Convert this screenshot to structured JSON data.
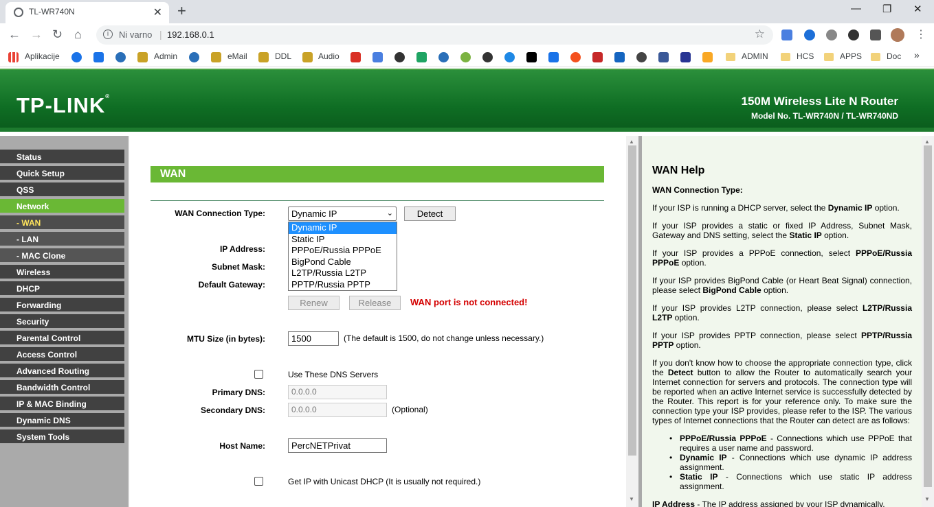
{
  "browser": {
    "tab_title": "TL-WR740N",
    "tab_close": "✕",
    "new_tab": "+",
    "security_label": "Ni varno",
    "url": "192.168.0.1",
    "bookmarks": [
      "Aplikacije",
      "Admin",
      "eMail",
      "DDL",
      "Audio",
      "ADMIN",
      "HCS",
      "APPS",
      "Doc"
    ],
    "more_bookmarks": "»"
  },
  "header": {
    "logo": "TP-LINK",
    "logo_reg": "®",
    "product": "150M Wireless Lite N Router",
    "model": "Model No. TL-WR740N / TL-WR740ND"
  },
  "menu": [
    "Status",
    "Quick Setup",
    "QSS",
    "Network",
    "- WAN",
    "- LAN",
    "- MAC Clone",
    "Wireless",
    "DHCP",
    "Forwarding",
    "Security",
    "Parental Control",
    "Access Control",
    "Advanced Routing",
    "Bandwidth Control",
    "IP & MAC Binding",
    "Dynamic DNS",
    "System Tools"
  ],
  "wan": {
    "title": "WAN",
    "conn_type_label": "WAN Connection Type:",
    "conn_type_value": "Dynamic IP",
    "detect": "Detect",
    "options": [
      "Dynamic IP",
      "Static IP",
      "PPPoE/Russia PPPoE",
      "BigPond Cable",
      "L2TP/Russia L2TP",
      "PPTP/Russia PPTP"
    ],
    "ip_label": "IP Address:",
    "mask_label": "Subnet Mask:",
    "gw_label": "Default Gateway:",
    "renew": "Renew",
    "release": "Release",
    "warning": "WAN port is not connected!",
    "mtu_label": "MTU Size (in bytes):",
    "mtu_value": "1500",
    "mtu_note": "(The default is 1500, do not change unless necessary.)",
    "dns_check_label": "Use These DNS Servers",
    "pdns_label": "Primary DNS:",
    "pdns_value": "0.0.0.0",
    "sdns_label": "Secondary DNS:",
    "sdns_value": "0.0.0.0",
    "optional": "(Optional)",
    "host_label": "Host Name:",
    "host_value": "PercNETPrivat",
    "unicast_label": "Get IP with Unicast DHCP (It is usually not required.)"
  },
  "help": {
    "title": "WAN Help",
    "subtitle": "WAN Connection Type:",
    "p1a": "If your ISP is running a DHCP server, select the ",
    "p1b": "Dynamic IP",
    "p1c": " option.",
    "p2a": "If your ISP provides a static or fixed IP Address, Subnet Mask, Gateway and DNS setting, select the ",
    "p2b": "Static IP",
    "p2c": " option.",
    "p3a": "If your ISP provides a PPPoE connection, select ",
    "p3b": "PPPoE/Russia PPPoE",
    "p3c": " option.",
    "p4a": "If your ISP provides BigPond Cable (or Heart Beat Signal) connection, please select ",
    "p4b": "BigPond Cable",
    "p4c": " option.",
    "p5a": "If your ISP provides L2TP connection, please select ",
    "p5b": "L2TP/Russia L2TP",
    "p5c": " option.",
    "p6a": "If your ISP provides PPTP connection, please select ",
    "p6b": "PPTP/Russia PPTP",
    "p6c": " option.",
    "p7a": "If you don't know how to choose the appropriate connection type, click the ",
    "p7b": "Detect",
    "p7c": " button to allow the Router to automatically search your Internet connection for servers and protocols. The connection type will be reported when an active Internet service is successfully detected by the Router. This report is for your reference only. To make sure the connection type your ISP provides, please refer to the ISP. The various types of Internet connections that the Router can detect are as follows:",
    "b1a": "PPPoE/Russia PPPoE",
    "b1b": " - Connections which use PPPoE that requires a user name and password.",
    "b2a": "Dynamic IP",
    "b2b": " - Connections which use dynamic IP address assignment.",
    "b3a": "Static IP",
    "b3b": " - Connections which use static IP address assignment.",
    "p8a": "IP Address",
    "p8b": " - The IP address assigned by your ISP dynamically."
  },
  "colors": {
    "green": "#6ab835",
    "header_green": "#0f6e24",
    "warning": "#d40000",
    "help_bg": "#f1f7ed"
  },
  "icons": [
    "globe-icon",
    "back-icon",
    "forward-icon",
    "reload-icon",
    "home-icon",
    "info-icon",
    "star-icon",
    "extension-icon",
    "profile-icon",
    "menu-icon"
  ]
}
